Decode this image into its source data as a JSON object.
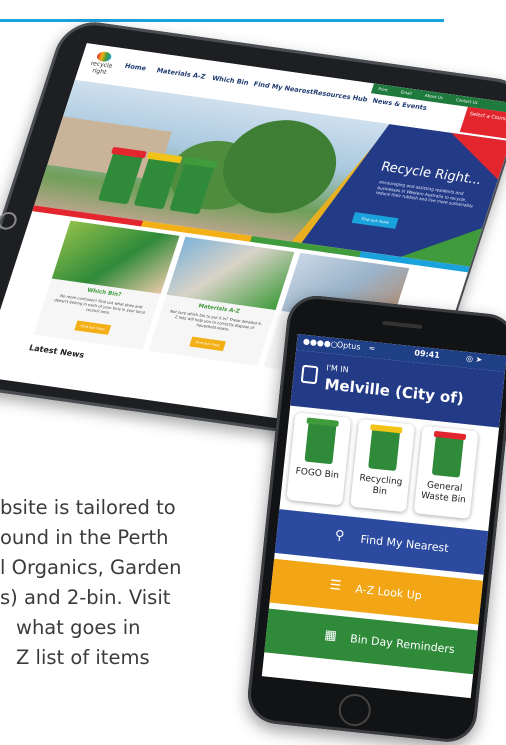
{
  "body_text": {
    "lines": [
      "bsite is tailored to",
      "ound in the Perth",
      "l Organics, Garden",
      "s) and 2-bin. Visit",
      "what goes in",
      "Z list of items"
    ]
  },
  "tablet": {
    "logo_label": "recycle right",
    "nav": {
      "home": "Home",
      "materials": "Materials A-Z",
      "which_bin": "Which Bin",
      "find_nearest": "Find My Nearest",
      "resources": "Resources Hub",
      "news": "News & Events"
    },
    "utility_links": [
      "Print",
      "Email",
      "About Us",
      "Contact Us",
      "Download the App"
    ],
    "select_council": "Select a Council",
    "hero": {
      "title": "Recycle Right...",
      "text": "encouraging and assisting residents and businesses in Western Australia to recycle, reduce their rubbish and live more sustainably.",
      "button": "Find out more"
    },
    "cards": [
      {
        "title": "Which Bin?",
        "text": "No more confusion! Find out what does and doesn't belong in each of your bins in your local council area.",
        "button": "Find out more"
      },
      {
        "title": "Materials A-Z",
        "text": "Not sure which bin to put it in? These detailed A-Z lists will help you to correctly dispose of household waste.",
        "button": "Find out more"
      }
    ],
    "latest_news": "Latest News"
  },
  "phone": {
    "status": {
      "carrier": "Optus",
      "time": "09:41"
    },
    "im_in": "I'M IN",
    "city": "Melville (City of)",
    "bins": [
      {
        "label": "FOGO Bin",
        "lid": "#3f9b3b"
      },
      {
        "label": "Recycling Bin",
        "lid": "#f2c417"
      },
      {
        "label": "General Waste Bin",
        "lid": "#e3262e"
      }
    ],
    "actions": [
      {
        "label": "Find My Nearest",
        "color": "#2b4aa0"
      },
      {
        "label": "A-Z Look Up",
        "color": "#f2a515"
      },
      {
        "label": "Bin Day Reminders",
        "color": "#2f8a3a"
      }
    ]
  },
  "colors": {
    "accent_blue": "#1aa2dd",
    "navy": "#233a86",
    "red": "#e3262e",
    "yellow": "#f2b016",
    "green": "#3f9b3b"
  }
}
